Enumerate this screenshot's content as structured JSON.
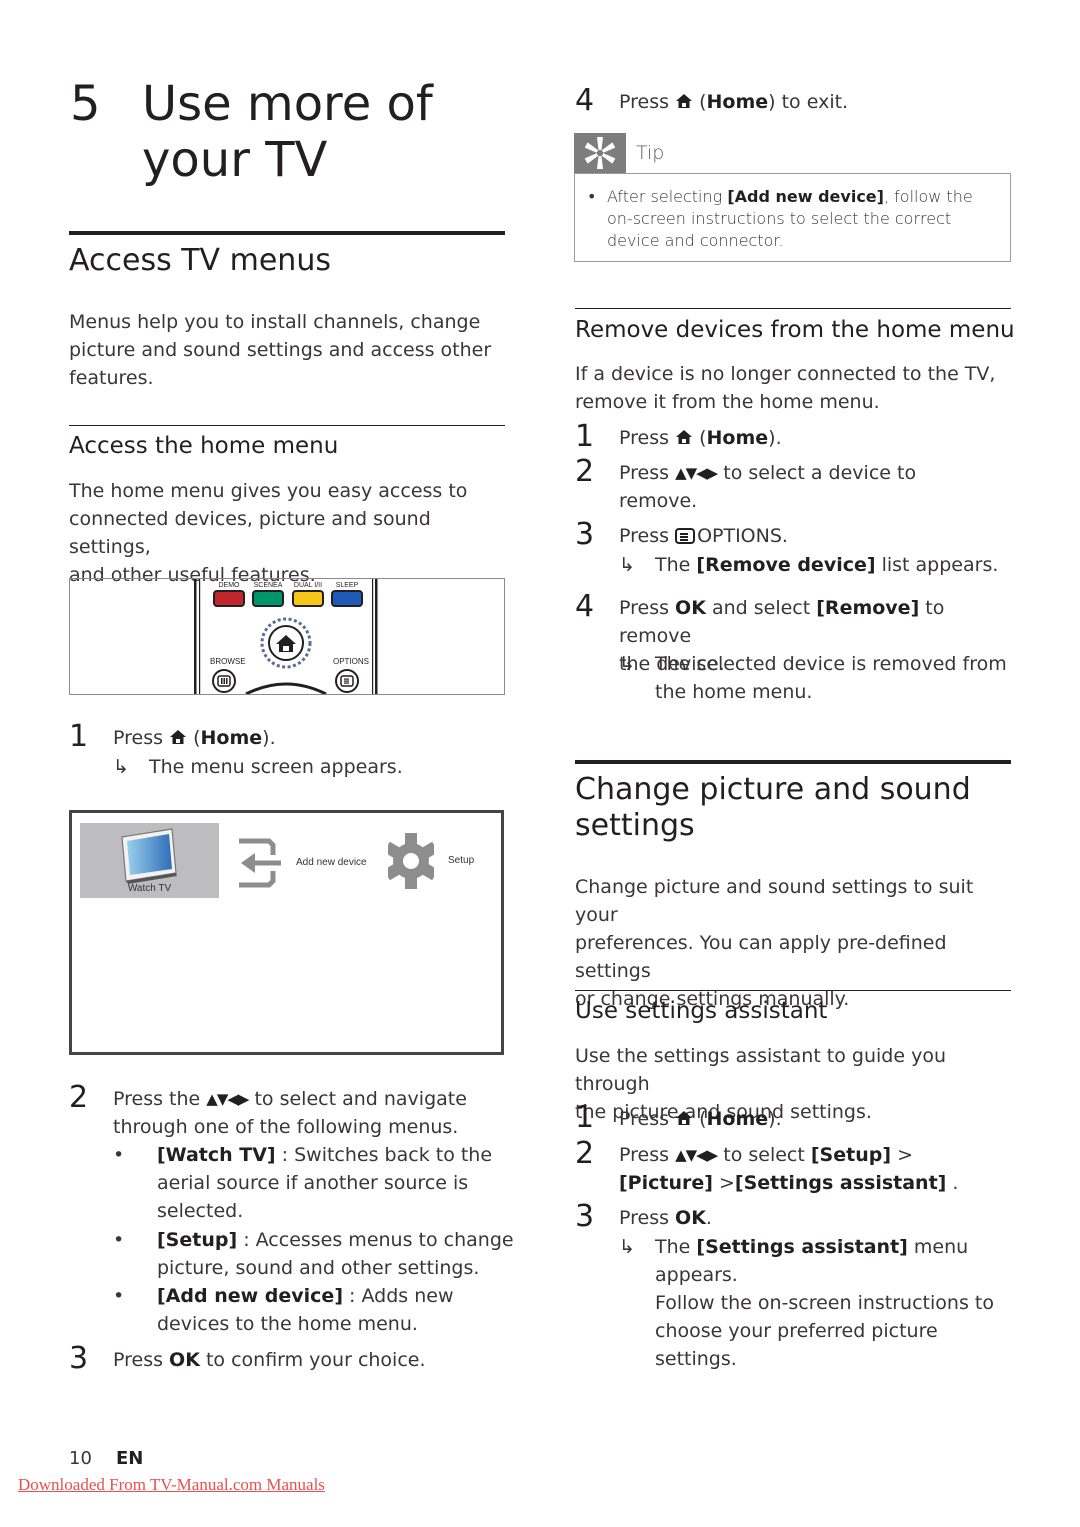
{
  "chapter": {
    "number": "5",
    "title_line1": "Use more of",
    "title_line2": "your TV"
  },
  "left": {
    "section_title": "Access TV menus",
    "intro": [
      "Menus help you to install channels, change",
      "picture and sound settings and access other",
      "features."
    ],
    "subsection_title": "Access the home menu",
    "sub_intro": [
      "The home menu gives you easy access to",
      "connected devices, picture and sound settings,",
      "and other useful features."
    ],
    "remote": {
      "buttons": [
        {
          "label": "DEMO",
          "color": "#c0272d"
        },
        {
          "label": "SCENEA",
          "color": "#00956b"
        },
        {
          "label": "DUAL I/II",
          "color": "#f5c518"
        },
        {
          "label": "SLEEP",
          "color": "#1f5ab8"
        }
      ],
      "browse_label": "BROWSE",
      "options_label": "OPTIONS"
    },
    "step1": {
      "num": "1",
      "pre": "Press",
      "bold": "Home",
      "post": ").",
      "open": " (",
      "result": "The menu screen appears."
    },
    "home_menu": {
      "watch_tv": "Watch TV",
      "add_new_device": "Add new device",
      "setup": "Setup"
    },
    "step2": {
      "num": "2",
      "line1_pre": "Press the",
      "line1_post": "to select and navigate",
      "line2": "through one of the following menus.",
      "bullets": [
        {
          "bold": "[Watch TV]",
          "lines": [
            " : Switches back to the",
            "aerial source if another source is",
            "selected."
          ]
        },
        {
          "bold": "[Setup]",
          "lines": [
            " : Accesses menus to change",
            "picture, sound and other settings."
          ]
        },
        {
          "bold": "[Add new device]",
          "lines": [
            " : Adds new",
            "devices to the home menu."
          ]
        }
      ]
    },
    "step3": {
      "num": "3",
      "pre": "Press ",
      "bold": "OK",
      "post": " to confirm your choice."
    }
  },
  "right": {
    "step4": {
      "num": "4",
      "pre": "Press",
      "open": " (",
      "bold": "Home",
      "post": ") to exit."
    },
    "tip": {
      "label": "Tip",
      "pre": "After selecting ",
      "bold": "[Add new device]",
      "post": ", follow the",
      "line2": "on-screen instructions to select the correct",
      "line3": "device and connector."
    },
    "remove": {
      "title": "Remove devices from the home menu",
      "intro": [
        "If a device is no longer connected to the TV,",
        "remove it from the home menu."
      ],
      "s1": {
        "num": "1",
        "pre": "Press",
        "open": " (",
        "bold": "Home",
        "post": ")."
      },
      "s2": {
        "num": "2",
        "pre": "Press",
        "post": "to select a device to",
        "line2": "remove."
      },
      "s3": {
        "num": "3",
        "pre": "Press",
        "post": "OPTIONS.",
        "r_pre": "The ",
        "r_bold": "[Remove device]",
        "r_post": " list appears."
      },
      "s4": {
        "num": "4",
        "pre": "Press ",
        "bold1": "OK",
        "mid": " and select ",
        "bold2": "[Remove]",
        "post": " to remove",
        "line2": "the device.",
        "r1": "The selected device is removed from",
        "r2": "the home menu."
      }
    },
    "change": {
      "title_line1": "Change picture and sound",
      "title_line2": "settings",
      "intro": [
        "Change picture and sound settings to suit your",
        "preferences. You can apply pre-defined settings",
        "or change settings manually."
      ]
    },
    "assistant": {
      "title": "Use settings assistant",
      "intro": [
        "Use the settings assistant to guide you through",
        "the picture and sound settings."
      ],
      "s1": {
        "num": "1",
        "pre": "Press",
        "open": " (",
        "bold": "Home",
        "post": ")."
      },
      "s2": {
        "num": "2",
        "pre": "Press",
        "post": "to select ",
        "bold1": "[Setup]",
        "gt": " >",
        "bold2": "[Picture]",
        "gt2": " >",
        "bold3": "[Settings assistant]",
        "end": " ."
      },
      "s3": {
        "num": "3",
        "pre": "Press ",
        "bold": "OK",
        "post": ".",
        "r_pre": "The ",
        "r_bold": "[Settings assistant]",
        "r_post": " menu appears.",
        "r2": "Follow the on-screen instructions to",
        "r3": "choose your preferred picture settings."
      }
    }
  },
  "footer": {
    "page": "10",
    "lang": "EN",
    "download": "Downloaded From TV-Manual.com Manuals"
  },
  "symbols": {
    "arrow": "↳",
    "nav": "▲▼◀▶",
    "bullet": "•"
  }
}
